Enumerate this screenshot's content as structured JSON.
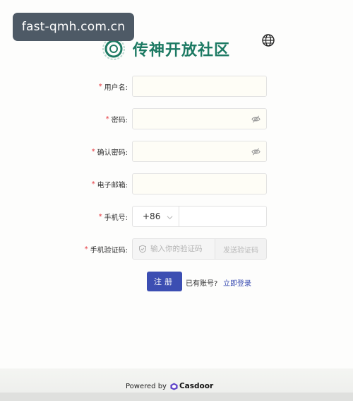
{
  "watermark": "fast-qmh.com.cn",
  "brand": {
    "name": "传神开放社区"
  },
  "form": {
    "username": {
      "label": "用户名:",
      "value": "",
      "placeholder": ""
    },
    "password": {
      "label": "密码:",
      "value": "",
      "placeholder": ""
    },
    "confirm_password": {
      "label": "确认密码:",
      "value": "",
      "placeholder": ""
    },
    "email": {
      "label": "电子邮箱:",
      "value": "",
      "placeholder": ""
    },
    "phone": {
      "label": "手机号:",
      "country_code": "+86",
      "value": "",
      "placeholder": ""
    },
    "sms_code": {
      "label": "手机验证码:",
      "placeholder": "输入你的验证码",
      "send_label": "发送验证码"
    },
    "required_mark": "*"
  },
  "actions": {
    "submit_label": "注册",
    "have_account": "已有账号?",
    "login_link": "立即登录"
  },
  "footer": {
    "powered_by": "Powered by",
    "vendor": "Casdoor"
  },
  "colors": {
    "brand_green": "#1d7a63",
    "primary_blue": "#3c4eb2",
    "required_red": "#e5333a"
  },
  "icons": {
    "language": "globe-icon",
    "password_toggle": "eye-off-icon",
    "code_prefix": "shield-icon",
    "country_select": "chevron-down-icon",
    "vendor_logo": "casdoor-logo-icon"
  }
}
